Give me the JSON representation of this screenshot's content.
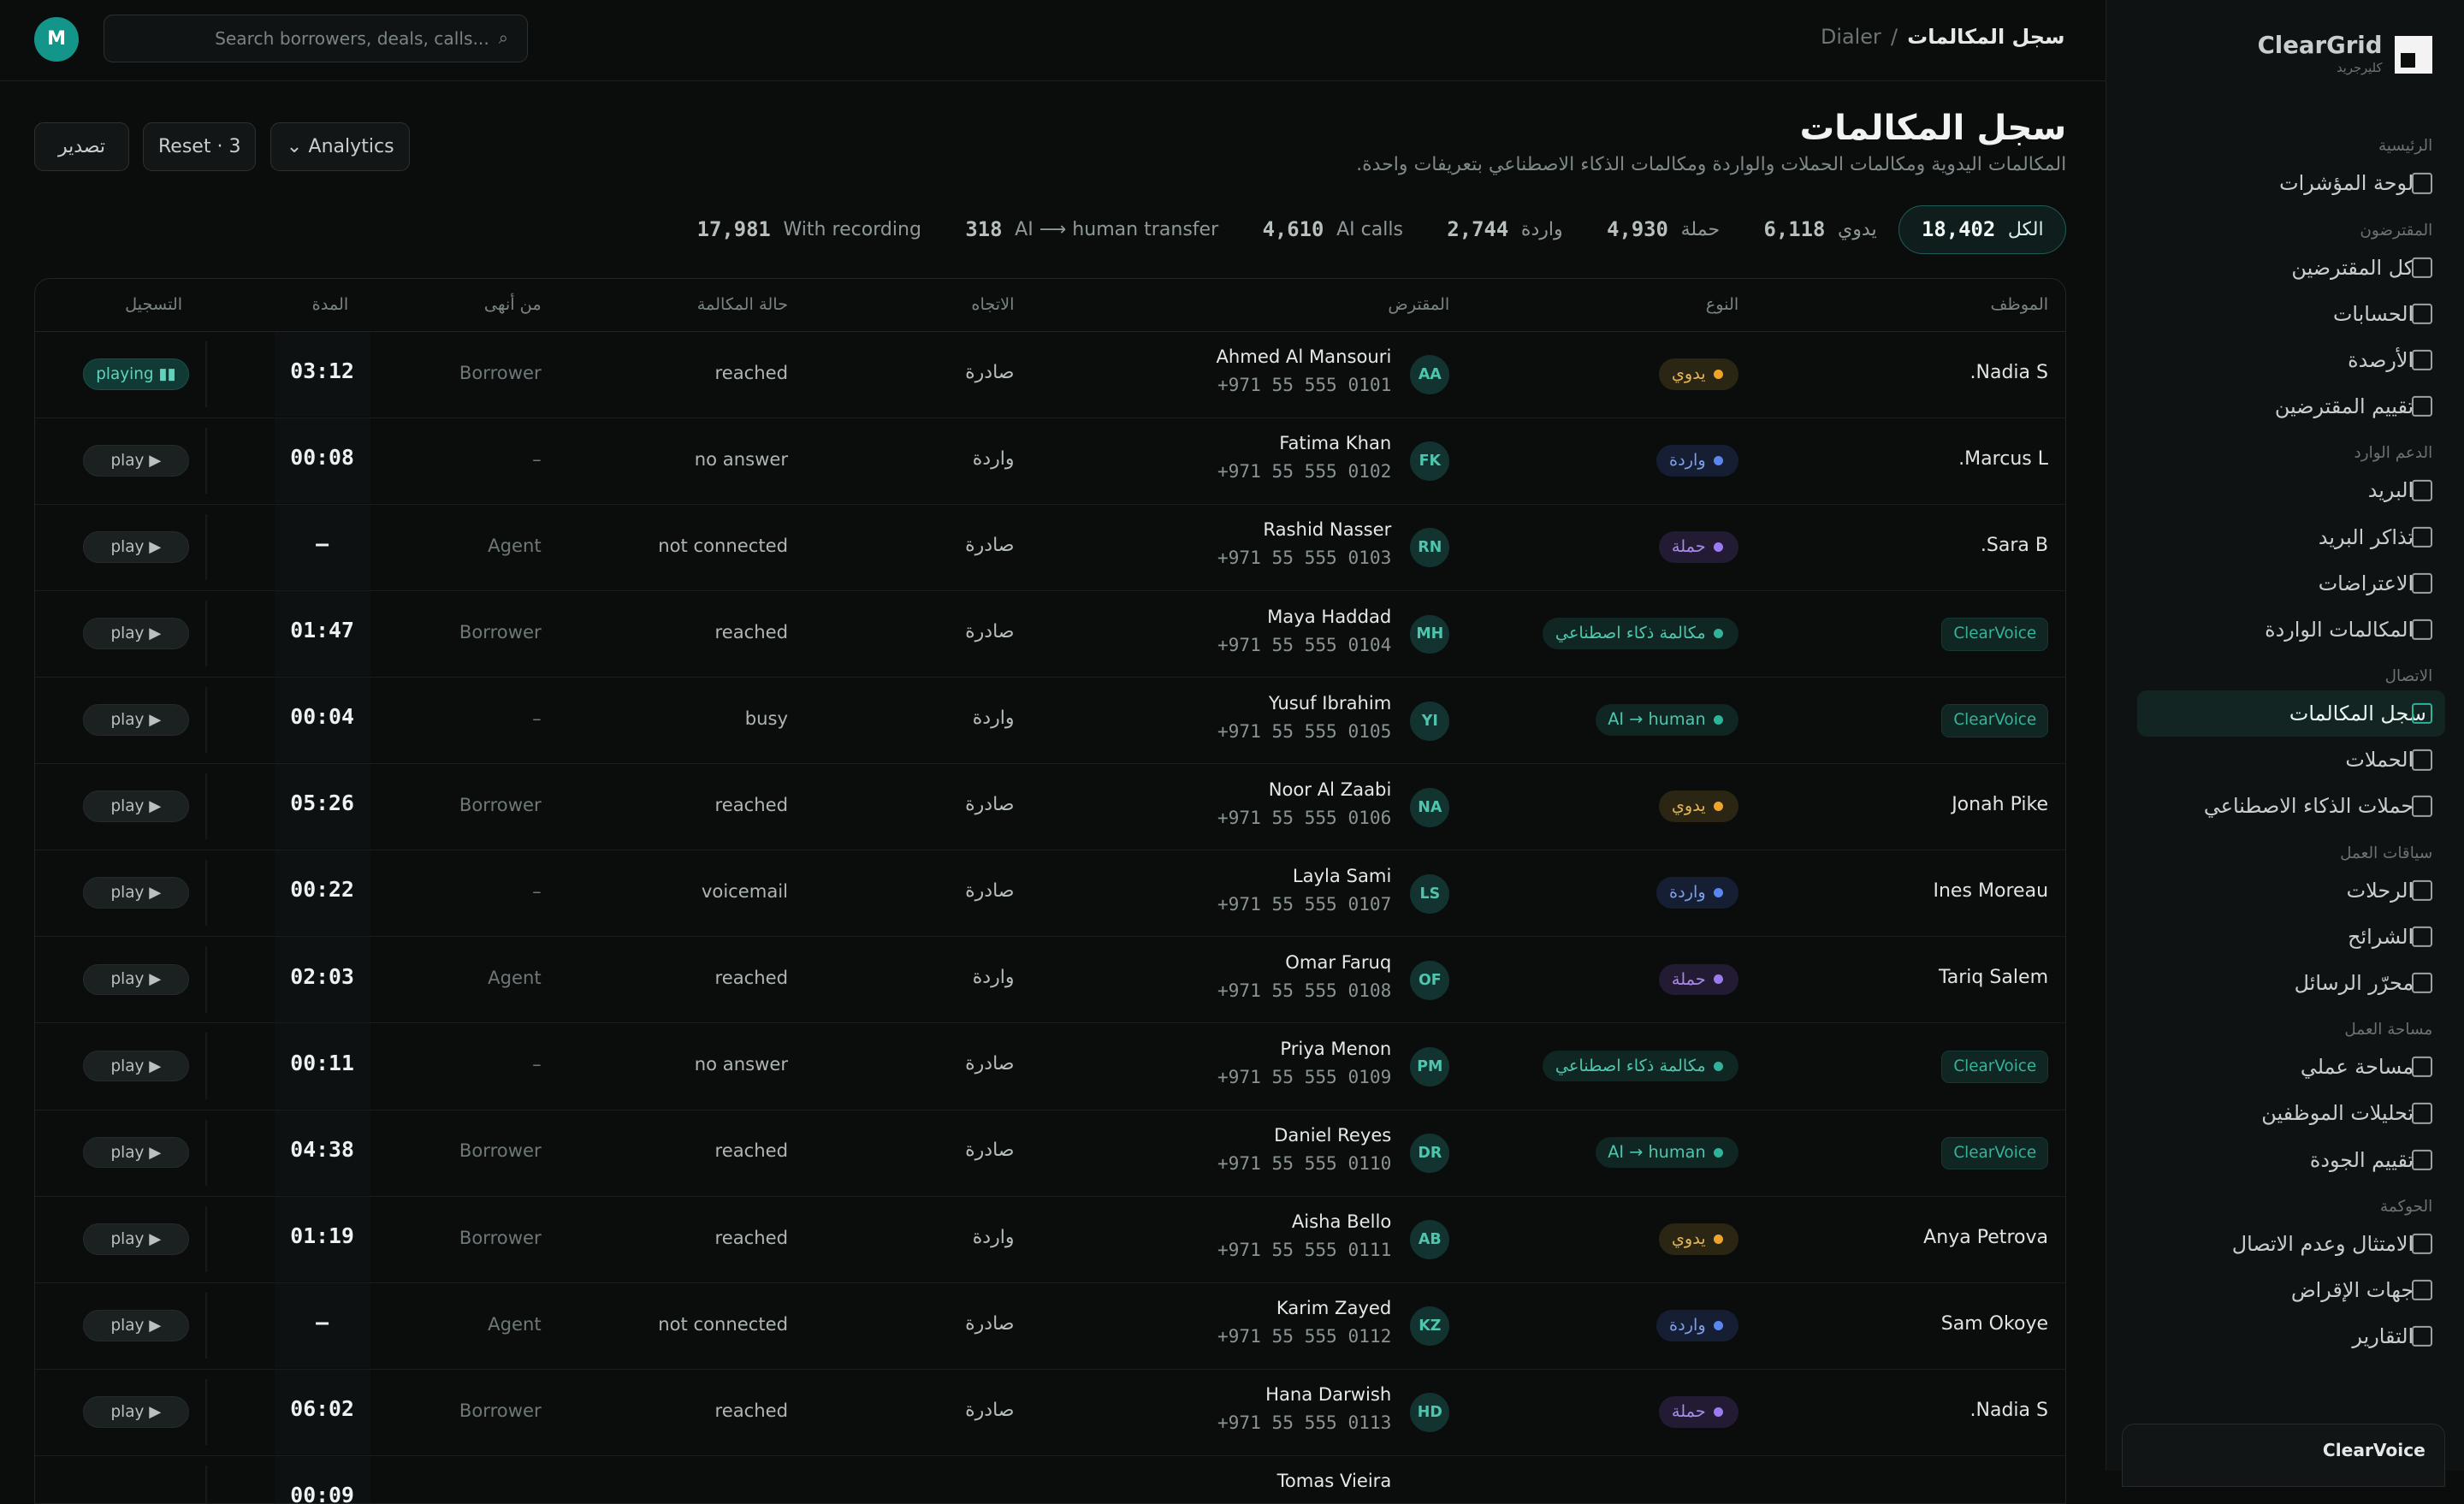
{
  "brand": {
    "name": "ClearGrid",
    "sub": "كليرجريد"
  },
  "topbar": {
    "avatar": "M",
    "search_placeholder": "Search borrowers, deals, calls...",
    "search_icon": "⌕",
    "crumb_current": "سجل المكالمات",
    "crumb_sep": "/",
    "crumb_parent": "Dialer"
  },
  "sidebar": {
    "sections": [
      {
        "title": "الرئيسية",
        "items": [
          "لوحة المؤشرات"
        ]
      },
      {
        "title": "المقترضون",
        "items": [
          "كل المقترضين",
          "الحسابات",
          "الأرصدة",
          "تقييم المقترضين"
        ]
      },
      {
        "title": "الدعم الوارد",
        "items": [
          "البريد",
          "تذاكر البريد",
          "الاعتراضات",
          "المكالمات الواردة"
        ]
      },
      {
        "title": "الاتصال",
        "items": [
          "سجل المكالمات",
          "الحملات",
          "حملات الذكاء الاصطناعي"
        ]
      },
      {
        "title": "سياقات العمل",
        "items": [
          "الرحلات",
          "الشرائح",
          "محرّر الرسائل"
        ]
      },
      {
        "title": "مساحة العمل",
        "items": [
          "مساحة عملي",
          "تحليلات الموظفين",
          "تقييم الجودة"
        ]
      },
      {
        "title": "الحوكمة",
        "items": [
          "الامتثال وعدم الاتصال",
          "جهات الإقراض",
          "التقارير"
        ]
      }
    ],
    "active_item": "سجل المكالمات",
    "bottom_card": "ClearVoice"
  },
  "header": {
    "title": "سجل المكالمات",
    "subtitle": "المكالمات اليدوية ومكالمات الحملات والواردة ومكالمات الذكاء الاصطناعي بتعريفات واحدة.",
    "export_label": "تصدير",
    "reset_label": "Reset · 3",
    "analytics_label": "Analytics",
    "analytics_icon": "⌄"
  },
  "stats": [
    {
      "label": "الكل",
      "value": "18,402",
      "active": true
    },
    {
      "label": "يدوي",
      "value": "6,118"
    },
    {
      "label": "حملة",
      "value": "4,930"
    },
    {
      "label": "واردة",
      "value": "2,744"
    },
    {
      "label": "AI calls",
      "value": "4,610"
    },
    {
      "label": "AI ⟶ human transfer",
      "value": "318"
    },
    {
      "label": "With recording",
      "value": "17,981"
    }
  ],
  "table": {
    "columns": {
      "agent": "الموظف",
      "type": "النوع",
      "borrower": "المقترض",
      "direction": "الاتجاه",
      "status": "حالة المكالمة",
      "ended_by": "من أنهى",
      "duration": "المدة",
      "recording": "التسجيل"
    },
    "rows": [
      {
        "agent": "Nadia S.",
        "agent_badge": false,
        "type": "يدوي",
        "type_key": "manual",
        "initials": "AA",
        "name": "Ahmed Al Mansouri",
        "phone": "+971 55 555 0101",
        "direction": "صادرة",
        "status": "reached",
        "ended_by": "Borrower",
        "duration": "03:12",
        "play": "playing ▮▮",
        "playing": true
      },
      {
        "agent": "Marcus L.",
        "agent_badge": false,
        "type": "واردة",
        "type_key": "inbound",
        "initials": "FK",
        "name": "Fatima Khan",
        "phone": "+971 55 555 0102",
        "direction": "واردة",
        "status": "no answer",
        "ended_by": "–",
        "duration": "00:08",
        "play": "play ▶",
        "playing": false
      },
      {
        "agent": "Sara B.",
        "agent_badge": false,
        "type": "حملة",
        "type_key": "campaign",
        "initials": "RN",
        "name": "Rashid Nasser",
        "phone": "+971 55 555 0103",
        "direction": "صادرة",
        "status": "not connected",
        "ended_by": "Agent",
        "duration": "—",
        "play": "play ▶",
        "playing": false
      },
      {
        "agent": "ClearVoice",
        "agent_badge": true,
        "type": "مكالمة ذكاء اصطناعي",
        "type_key": "ai",
        "initials": "MH",
        "name": "Maya Haddad",
        "phone": "+971 55 555 0104",
        "direction": "صادرة",
        "status": "reached",
        "ended_by": "Borrower",
        "duration": "01:47",
        "play": "play ▶",
        "playing": false
      },
      {
        "agent": "ClearVoice",
        "agent_badge": true,
        "type": "AI → human",
        "type_key": "handoff",
        "initials": "YI",
        "name": "Yusuf Ibrahim",
        "phone": "+971 55 555 0105",
        "direction": "واردة",
        "status": "busy",
        "ended_by": "–",
        "duration": "00:04",
        "play": "play ▶",
        "playing": false
      },
      {
        "agent": "Jonah Pike",
        "agent_badge": false,
        "type": "يدوي",
        "type_key": "manual",
        "initials": "NA",
        "name": "Noor Al Zaabi",
        "phone": "+971 55 555 0106",
        "direction": "صادرة",
        "status": "reached",
        "ended_by": "Borrower",
        "duration": "05:26",
        "play": "play ▶",
        "playing": false
      },
      {
        "agent": "Ines Moreau",
        "agent_badge": false,
        "type": "واردة",
        "type_key": "inbound",
        "initials": "LS",
        "name": "Layla Sami",
        "phone": "+971 55 555 0107",
        "direction": "صادرة",
        "status": "voicemail",
        "ended_by": "–",
        "duration": "00:22",
        "play": "play ▶",
        "playing": false
      },
      {
        "agent": "Tariq Salem",
        "agent_badge": false,
        "type": "حملة",
        "type_key": "campaign",
        "initials": "OF",
        "name": "Omar Faruq",
        "phone": "+971 55 555 0108",
        "direction": "واردة",
        "status": "reached",
        "ended_by": "Agent",
        "duration": "02:03",
        "play": "play ▶",
        "playing": false
      },
      {
        "agent": "ClearVoice",
        "agent_badge": true,
        "type": "مكالمة ذكاء اصطناعي",
        "type_key": "ai",
        "initials": "PM",
        "name": "Priya Menon",
        "phone": "+971 55 555 0109",
        "direction": "صادرة",
        "status": "no answer",
        "ended_by": "–",
        "duration": "00:11",
        "play": "play ▶",
        "playing": false
      },
      {
        "agent": "ClearVoice",
        "agent_badge": true,
        "type": "AI → human",
        "type_key": "handoff",
        "initials": "DR",
        "name": "Daniel Reyes",
        "phone": "+971 55 555 0110",
        "direction": "صادرة",
        "status": "reached",
        "ended_by": "Borrower",
        "duration": "04:38",
        "play": "play ▶",
        "playing": false
      },
      {
        "agent": "Anya Petrova",
        "agent_badge": false,
        "type": "يدوي",
        "type_key": "manual",
        "initials": "AB",
        "name": "Aisha Bello",
        "phone": "+971 55 555 0111",
        "direction": "واردة",
        "status": "reached",
        "ended_by": "Borrower",
        "duration": "01:19",
        "play": "play ▶",
        "playing": false
      },
      {
        "agent": "Sam Okoye",
        "agent_badge": false,
        "type": "واردة",
        "type_key": "inbound",
        "initials": "KZ",
        "name": "Karim Zayed",
        "phone": "+971 55 555 0112",
        "direction": "صادرة",
        "status": "not connected",
        "ended_by": "Agent",
        "duration": "—",
        "play": "play ▶",
        "playing": false
      },
      {
        "agent": "Nadia S.",
        "agent_badge": false,
        "type": "حملة",
        "type_key": "campaign",
        "initials": "HD",
        "name": "Hana Darwish",
        "phone": "+971 55 555 0113",
        "direction": "صادرة",
        "status": "reached",
        "ended_by": "Borrower",
        "duration": "06:02",
        "play": "play ▶",
        "playing": false
      },
      {
        "agent": "",
        "agent_badge": false,
        "type": "",
        "type_key": "",
        "initials": "",
        "name": "Tomas Vieira",
        "phone": "",
        "direction": "",
        "status": "",
        "ended_by": "",
        "duration": "00:09",
        "play": "",
        "playing": false
      }
    ]
  },
  "colors": {
    "accent": "#2fb39a",
    "background": "#0b0d0d",
    "manual": "#f0a32a",
    "inbound": "#5b86f0",
    "campaign": "#9c7bf2"
  }
}
